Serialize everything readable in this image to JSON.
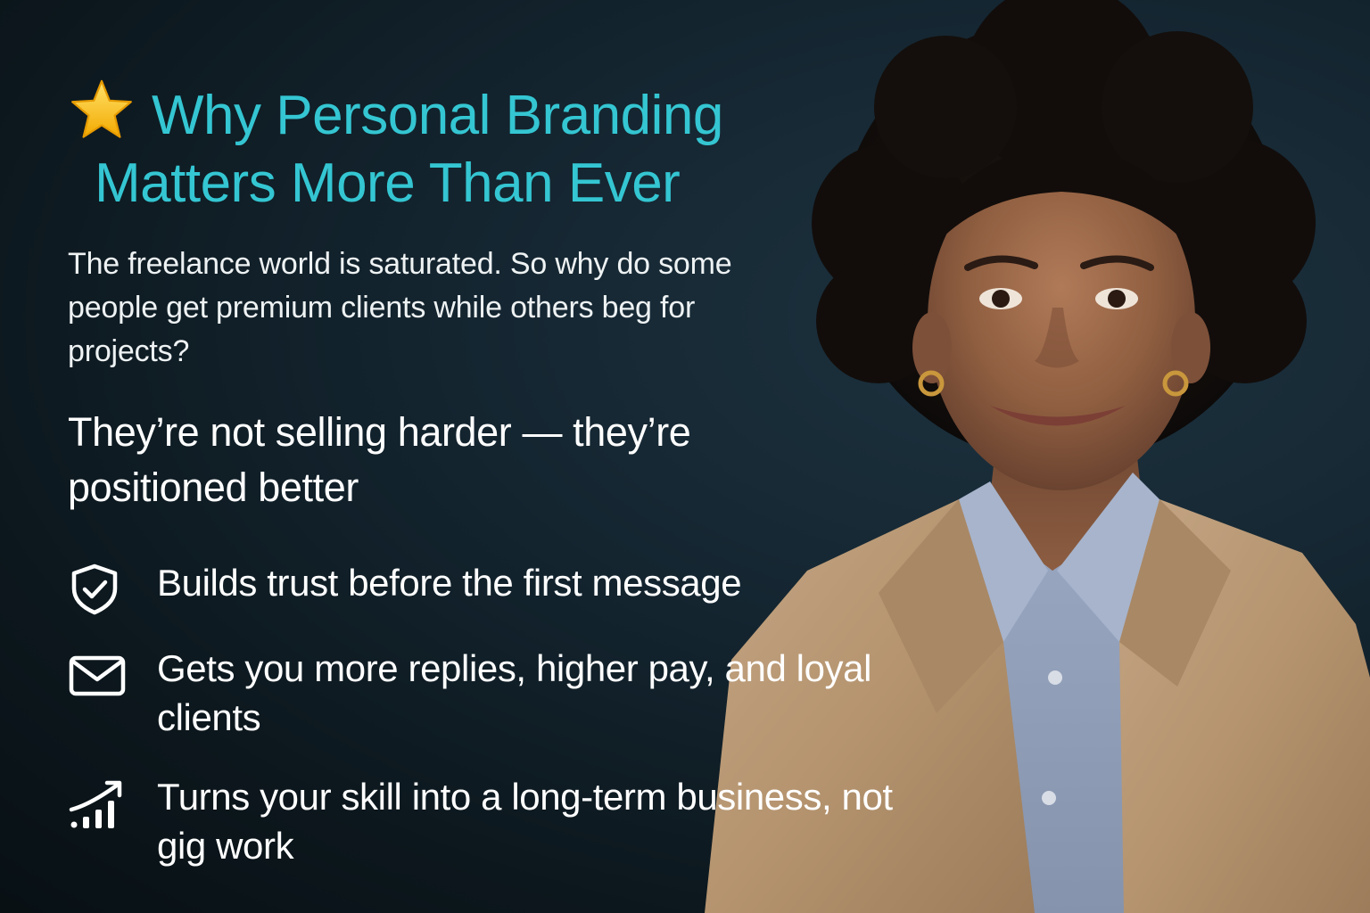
{
  "title": {
    "line1": "Why Personal Branding",
    "line2": "Matters More Than Ever",
    "icon": "star-icon"
  },
  "intro": {
    "text": "The freelance world is saturated. So why do some people get premium clients while others beg for projects?"
  },
  "subhead": {
    "text": "They’re not selling harder — they’re positioned better"
  },
  "benefits": [
    {
      "icon": "shield-check-icon",
      "text": "Builds trust before the first message"
    },
    {
      "icon": "envelope-icon",
      "text": "Gets you more replies, higher pay, and loyal clients"
    },
    {
      "icon": "growth-chart-icon",
      "text": "Turns your skill into a long-term business, not gig work"
    }
  ],
  "colors": {
    "title": "#34c6d2",
    "body_text": "#ffffff",
    "background": "#0f1e26",
    "star": "#f5c518"
  }
}
